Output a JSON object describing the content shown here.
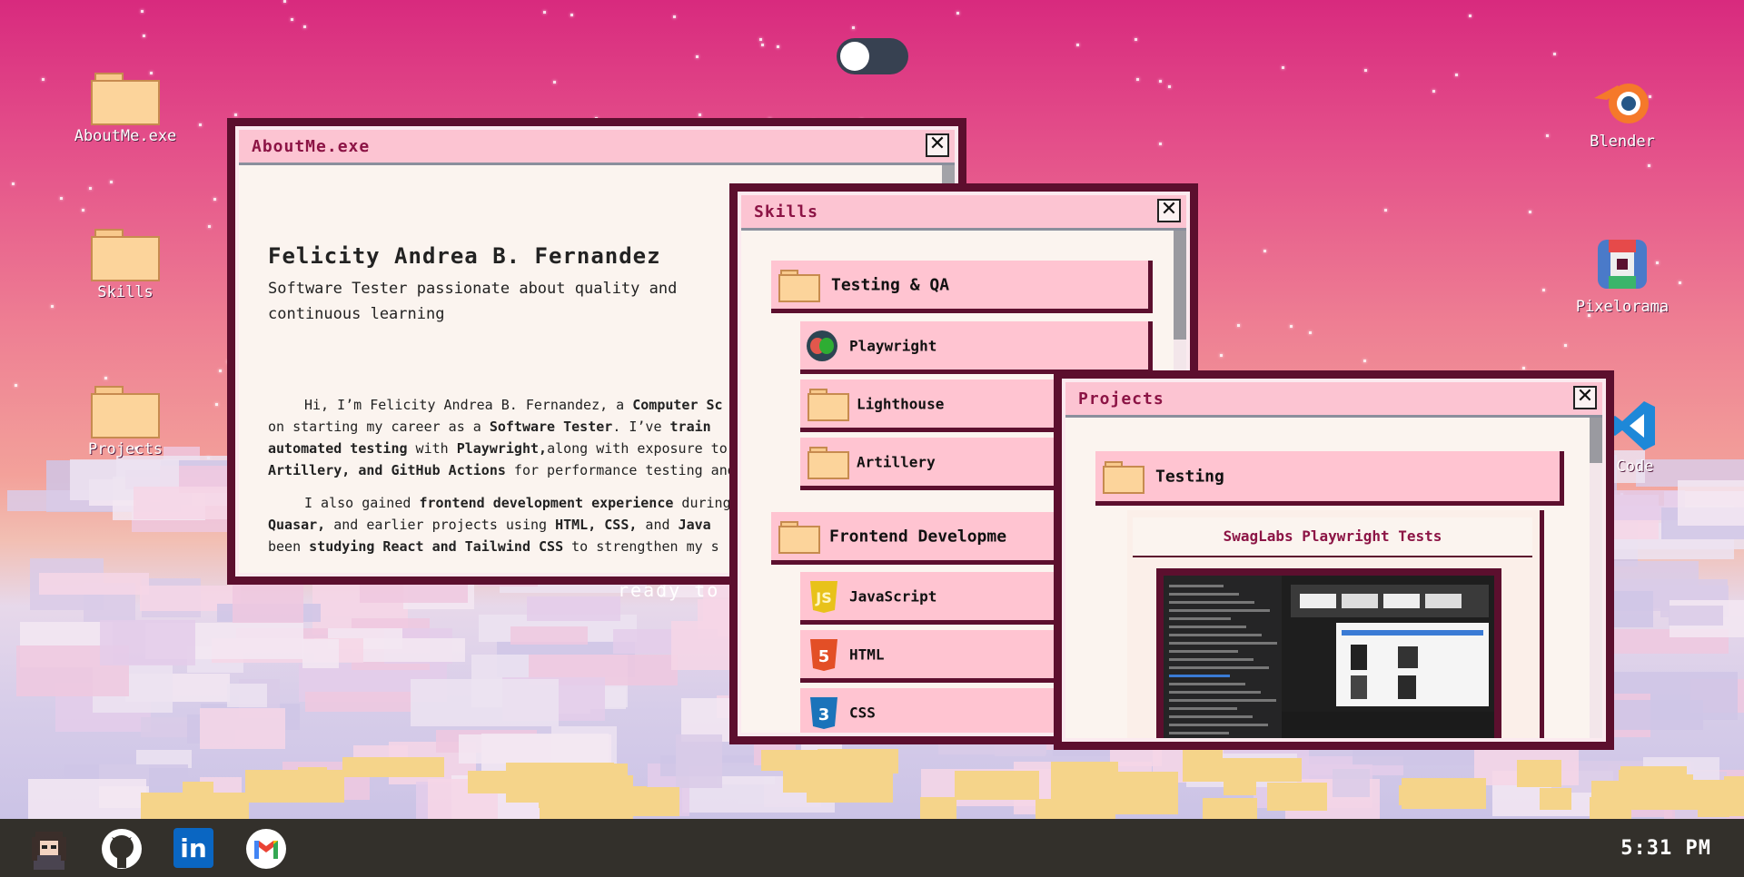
{
  "desktop": {
    "icons_left": [
      {
        "label": "AboutMe.exe"
      },
      {
        "label": "Skills"
      },
      {
        "label": "Projects"
      }
    ],
    "icons_right": [
      {
        "label": "Blender"
      },
      {
        "label": "Pixelorama"
      },
      {
        "label": "Code"
      }
    ],
    "background_text": "ready to c"
  },
  "about_window": {
    "title": "AboutMe.exe",
    "close": "✕",
    "name": "Felicity Andrea B. Fernandez",
    "tagline": "Software Tester passionate about quality and continuous learning",
    "para1": {
      "a": "Hi, I’m Felicity Andrea B. Fernandez, a ",
      "b": "Computer Sc",
      "c": " on starting my career as a ",
      "d": "Software Tester",
      "e": ". I’ve ",
      "f": "train",
      "g": "automated testing",
      "h": " with ",
      "i": "Playwright,",
      "j": "along with exposure to ",
      "k": "Artillery, and GitHub Actions",
      "l": " for performance testing and"
    },
    "para2": {
      "a": "I also gained ",
      "b": "frontend development experience",
      "c": " during ",
      "d": "Quasar,",
      "e": " and earlier projects using ",
      "f": "HTML, CSS,",
      "g": " and ",
      "h": "Java",
      "i": "been ",
      "j": "studying React and Tailwind CSS",
      "k": " to strengthen my s"
    }
  },
  "skills_window": {
    "title": "Skills",
    "close": "✕",
    "groups": [
      {
        "label": "Testing & QA",
        "items": [
          "Playwright",
          "Lighthouse",
          "Artillery"
        ]
      },
      {
        "label": "Frontend Developme",
        "items": [
          "JavaScript",
          "HTML",
          "CSS"
        ]
      }
    ],
    "icons": {
      "Playwright": "playwright-icon",
      "JavaScript": "javascript-icon",
      "HTML": "html5-icon",
      "CSS": "css3-icon"
    }
  },
  "projects_window": {
    "title": "Projects",
    "close": "✕",
    "folder_label": "Testing",
    "card_title": "SwagLabs Playwright Tests"
  },
  "toggle": {
    "state": "off"
  },
  "taskbar": {
    "items": [
      "avatar",
      "github-icon",
      "linkedin-icon",
      "gmail-icon"
    ],
    "linkedin_text": "in",
    "time": "5:31 PM"
  },
  "colors": {
    "accent": "#5c0f2e",
    "row_bg": "#ffc4d1",
    "title_text": "#8c1445"
  }
}
